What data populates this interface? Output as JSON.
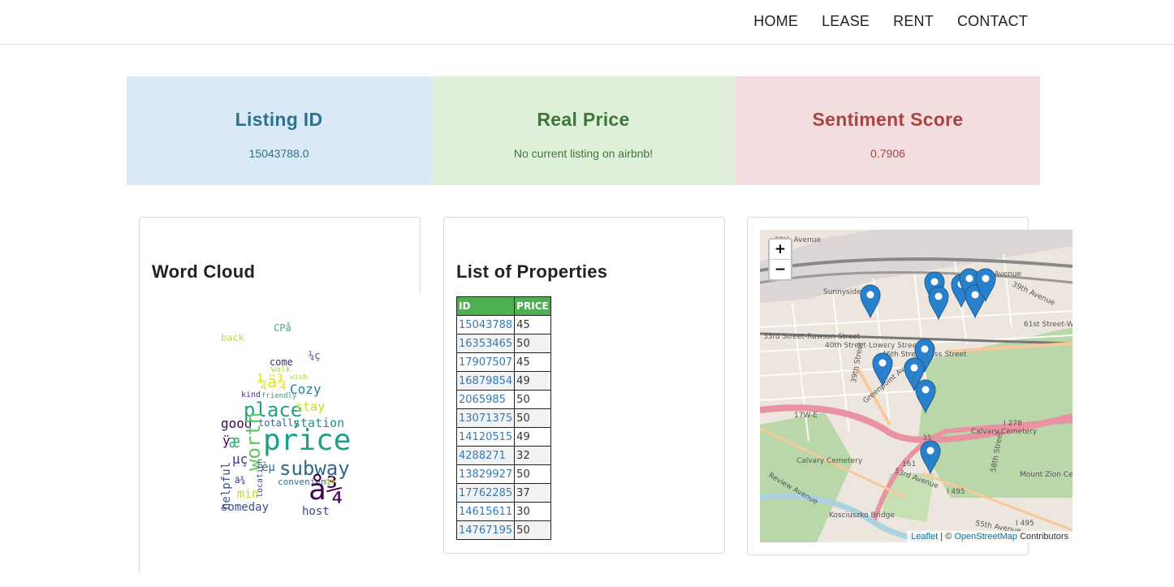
{
  "nav": {
    "items": [
      "HOME",
      "LEASE",
      "RENT",
      "CONTACT"
    ]
  },
  "stats": {
    "listing": {
      "title": "Listing ID",
      "value": "15043788.0"
    },
    "price": {
      "title": "Real Price",
      "value": "No current listing on airbnb!"
    },
    "sentiment": {
      "title": "Sentiment Score",
      "value": "0.7906"
    }
  },
  "wordcloud": {
    "title": "Word Cloud",
    "words": [
      {
        "text": "CPå",
        "color": "#3bb08f"
      },
      {
        "text": "back",
        "color": "#c8d93a"
      },
      {
        "text": "¼ç",
        "color": "#3b528b"
      },
      {
        "text": "come",
        "color": "#482575"
      },
      {
        "text": "walk",
        "color": "#a6d83b"
      },
      {
        "text": "wish",
        "color": "#a6d83b"
      },
      {
        "text": "¼ä¾",
        "color": "#dde318"
      },
      {
        "text": "kind",
        "color": "#46327e"
      },
      {
        "text": "friendly",
        "color": "#2a9d8f"
      },
      {
        "text": "Cozy",
        "color": "#26828e"
      },
      {
        "text": "place",
        "color": "#1fa187"
      },
      {
        "text": "stay",
        "color": "#c2df23"
      },
      {
        "text": "good",
        "color": "#440154"
      },
      {
        "text": "totally",
        "color": "#31688e"
      },
      {
        "text": "station",
        "color": "#21918c"
      },
      {
        "text": "ÿ",
        "color": "#440154"
      },
      {
        "text": "æ",
        "color": "#35b779"
      },
      {
        "text": "worth",
        "color": "#5ec962"
      },
      {
        "text": "location",
        "color": "#3e4989"
      },
      {
        "text": "price",
        "color": "#1f9e89"
      },
      {
        "text": "µç",
        "color": "#46327e"
      },
      {
        "text": "èµ",
        "color": "#31688e"
      },
      {
        "text": "subway",
        "color": "#31688e"
      },
      {
        "text": "convenient",
        "color": "#2c728e"
      },
      {
        "text": "helpful",
        "color": "#3b528b"
      },
      {
        "text": "ä¾",
        "color": "#482878"
      },
      {
        "text": "min",
        "color": "#c2df23"
      },
      {
        "text": "å¾",
        "color": "#440154"
      },
      {
        "text": "6å",
        "color": "#dde318"
      },
      {
        "text": "someday",
        "color": "#3b528b"
      },
      {
        "text": "host",
        "color": "#3e4989"
      }
    ]
  },
  "properties": {
    "title": "List of Properties",
    "columns": [
      "ID",
      "PRICE"
    ],
    "rows": [
      [
        "15043788",
        "45"
      ],
      [
        "16353465",
        "50"
      ],
      [
        "17907507",
        "45"
      ],
      [
        "16879854",
        "49"
      ],
      [
        "2065985",
        "50"
      ],
      [
        "13071375",
        "50"
      ],
      [
        "14120515",
        "49"
      ],
      [
        "4288271",
        "32"
      ],
      [
        "13829927",
        "50"
      ],
      [
        "17762285",
        "37"
      ],
      [
        "14615611",
        "30"
      ],
      [
        "14767195",
        "50"
      ]
    ]
  },
  "map": {
    "zoom_in": "+",
    "zoom_out": "−",
    "attribution": {
      "leaflet": "Leaflet",
      "sep": " | © ",
      "osm": "OpenStreetMap",
      "suffix": " Contributors"
    },
    "labels": [
      "39th Avenue",
      "Sunnyside Yard",
      "39th Avenue",
      "39th Avenue",
      "61st Street-Wo",
      "33rd Street-Rawson Street",
      "40th Street-Lowery Street",
      "46th Street-Bliss Street",
      "39th Street",
      "Greenpoint Avenue",
      "17W-E",
      "Calvary Cemetery",
      "I 278",
      "Calvary Cemetery",
      "35",
      "161",
      "53rd Avenue",
      "I 495",
      "Review Avenue",
      "Mount Zion Cemetery",
      "Kosciuszko Bridge",
      "55th Avenue",
      "I 495",
      "58th Street"
    ],
    "marker_color": "#2a81cb"
  }
}
